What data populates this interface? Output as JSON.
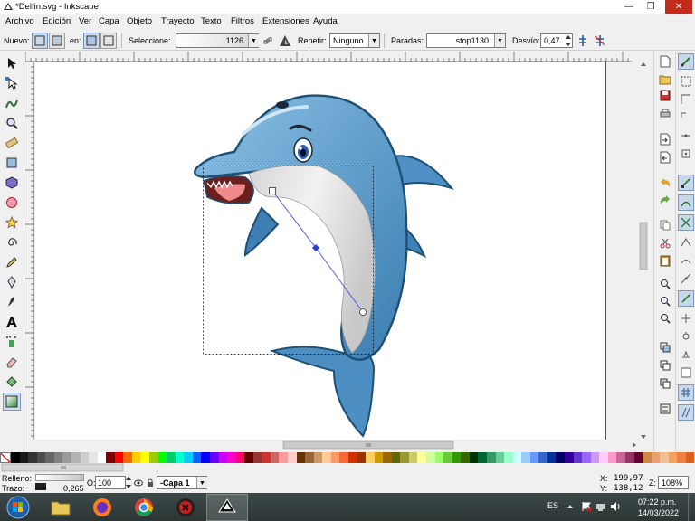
{
  "window": {
    "title": "*Delfin.svg - Inkscape",
    "buttons": {
      "minimize": "—",
      "maximize": "❐",
      "close": "✕"
    }
  },
  "menubar": [
    "Archivo",
    "Edición",
    "Ver",
    "Capa",
    "Objeto",
    "Trayecto",
    "Texto",
    "Filtros",
    "Extensiones",
    "Ayuda"
  ],
  "toolbar": {
    "new_label": "Nuevo:",
    "on_label": "en:",
    "selection_label": "Seleccione:",
    "selection_value": "1126",
    "repeat_label": "Repetir:",
    "repeat_value": "Ninguno",
    "stops_label": "Paradas:",
    "stops_value": "stop1130",
    "offset_label": "Desvío:",
    "offset_value": "0,47"
  },
  "tools": [
    "selector-tool",
    "node-tool",
    "tweak-tool",
    "zoom-tool",
    "measure-tool",
    "rect-tool",
    "3dbox-tool",
    "ellipse-tool",
    "star-tool",
    "spiral-tool",
    "pencil-tool",
    "pen-tool",
    "calligraphy-tool",
    "text-tool",
    "spray-tool",
    "eraser-tool",
    "bucket-tool",
    "gradient-tool"
  ],
  "status": {
    "fill_label": "Relleno:",
    "stroke_label": "Trazo:",
    "stroke_value": "0,265",
    "opacity_label": "O:",
    "opacity_value": "100",
    "layer_value": "-Capa 1",
    "x_label": "X:",
    "x_value": "199,97",
    "y_label": "Y:",
    "y_value": "138,12",
    "zoom_label": "Z:",
    "zoom_value": "108%"
  },
  "taskbar": {
    "language": "ES",
    "time": "07:22 p.m.",
    "date": "14/03/2022"
  },
  "colors": {
    "accent": "#4f8fc4",
    "dolphin_dark": "#2b6a96",
    "dolphin_light": "#6aa6d3",
    "belly": "#e8e8e8",
    "close_red": "#c42b1c"
  },
  "palette": [
    "#000000",
    "#1a1a1a",
    "#333333",
    "#4d4d4d",
    "#666666",
    "#808080",
    "#999999",
    "#b3b3b3",
    "#cccccc",
    "#e6e6e6",
    "#ffffff",
    "#800000",
    "#ff0000",
    "#ff6600",
    "#ffcc00",
    "#ffff00",
    "#99cc00",
    "#00ff00",
    "#00cc66",
    "#00ffcc",
    "#00ccff",
    "#0066ff",
    "#0000ff",
    "#6600ff",
    "#cc00ff",
    "#ff00cc",
    "#ff0066",
    "#660000",
    "#993333",
    "#cc3333",
    "#cc6666",
    "#ff9999",
    "#ffcccc",
    "#663300",
    "#996633",
    "#cc9966",
    "#ffcc99",
    "#ff9966",
    "#ff6633",
    "#cc3300",
    "#993300",
    "#ffcc66",
    "#cc9900",
    "#996600",
    "#666600",
    "#999933",
    "#cccc66",
    "#ffff99",
    "#ccff99",
    "#99ff66",
    "#66cc33",
    "#339900",
    "#336600",
    "#003300",
    "#006633",
    "#339966",
    "#66cc99",
    "#99ffcc",
    "#ccffff",
    "#99ccff",
    "#6699ff",
    "#3366cc",
    "#003399",
    "#000066",
    "#330099",
    "#6633cc",
    "#9966ff",
    "#cc99ff",
    "#ffccff",
    "#ff99cc",
    "#cc6699",
    "#993366",
    "#660033",
    "#cc8844",
    "#e8a070",
    "#f2c090",
    "#f5a060",
    "#f08040",
    "#e06020"
  ]
}
